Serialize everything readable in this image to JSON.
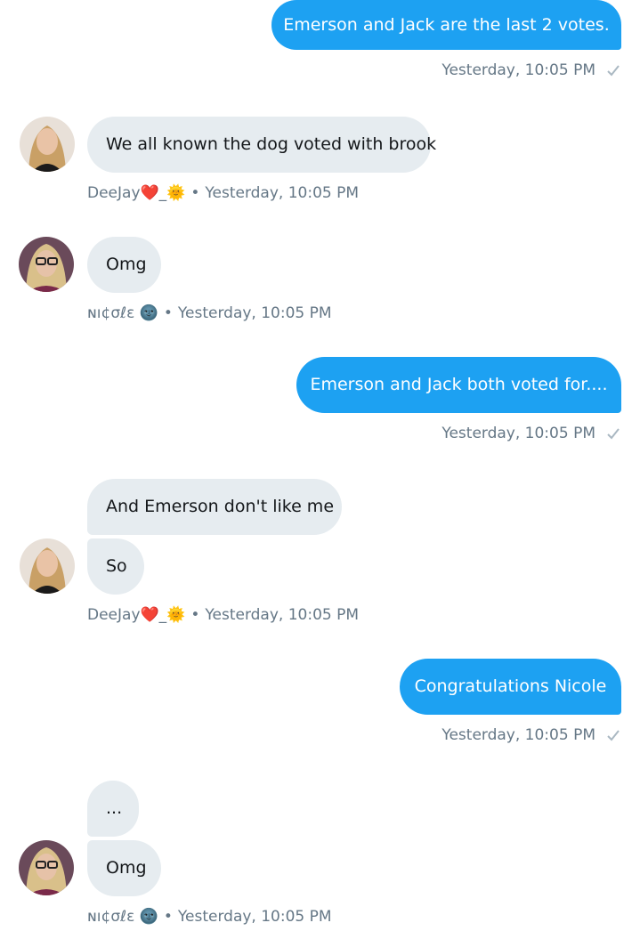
{
  "conversation": {
    "messages": [
      {
        "direction": "outgoing",
        "text": "Emerson and Jack are the last 2 votes.",
        "timestamp": "Yesterday, 10:05 PM"
      },
      {
        "direction": "incoming",
        "sender": "DeeJay❤️_🌞",
        "text": "We all known the dog voted with brook",
        "timestamp": "Yesterday, 10:05 PM"
      },
      {
        "direction": "incoming",
        "sender": "ɴı¢σℓε 🌚",
        "text": "Omg",
        "timestamp": "Yesterday, 10:05 PM"
      },
      {
        "direction": "outgoing",
        "text": "Emerson and Jack both voted for....",
        "timestamp": "Yesterday, 10:05 PM"
      },
      {
        "direction": "incoming",
        "sender": "DeeJay❤️_🌞",
        "texts": [
          "And Emerson don't like me",
          "So"
        ],
        "timestamp": "Yesterday, 10:05 PM"
      },
      {
        "direction": "outgoing",
        "text": "Congratulations Nicole",
        "timestamp": "Yesterday, 10:05 PM"
      },
      {
        "direction": "incoming",
        "sender": "ɴı¢σℓε 🌚",
        "texts": [
          "...",
          "Omg"
        ],
        "timestamp": "Yesterday, 10:05 PM"
      }
    ],
    "senders": {
      "deejay_name": "DeeJay",
      "nicole_name": "ɴı¢σℓε",
      "separator": "•"
    }
  },
  "colors": {
    "outgoing_bubble": "#1da1f2",
    "incoming_bubble": "#e6ecf0",
    "meta_text": "#657786",
    "read_check": "#aab8c2"
  },
  "icons": {
    "read_receipt": "checkmark-icon",
    "heart": "red-heart-icon",
    "sun": "sun-with-face-icon",
    "moon": "new-moon-face-icon"
  }
}
